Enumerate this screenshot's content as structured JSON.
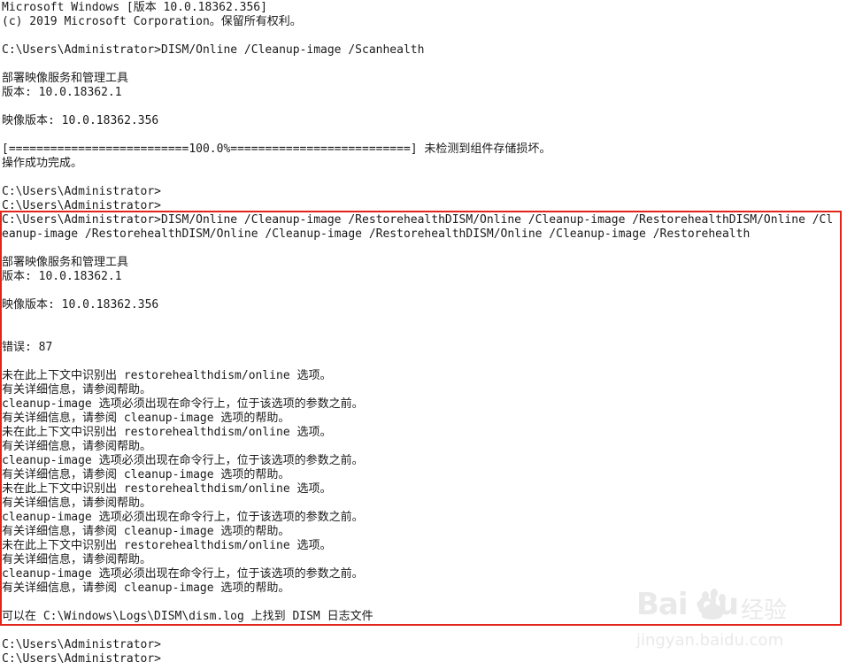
{
  "window": {
    "title_line": "Microsoft Windows [版本 10.0.18362.356]",
    "copyright_line": "(c) 2019 Microsoft Corporation。保留所有权利。"
  },
  "session1": {
    "command": "C:\\Users\\Administrator>DISM/Online /Cleanup-image /Scanhealth",
    "tool_name": "部署映像服务和管理工具",
    "tool_version": "版本: 10.0.18362.1",
    "image_version": "映像版本: 10.0.18362.356",
    "progress": "[==========================100.0%==========================] 未检测到组件存储损坏。",
    "result": "操作成功完成。",
    "prompt1": "C:\\Users\\Administrator>",
    "prompt2": "C:\\Users\\Administrator>"
  },
  "session2": {
    "command_line1": "C:\\Users\\Administrator>DISM/Online /Cleanup-image /RestorehealthDISM/Online /Cleanup-image /RestorehealthDISM/Online /Cl",
    "command_line2": "eanup-image /RestorehealthDISM/Online /Cleanup-image /RestorehealthDISM/Online /Cleanup-image /Restorehealth",
    "tool_name": "部署映像服务和管理工具",
    "tool_version": "版本: 10.0.18362.1",
    "image_version": "映像版本: 10.0.18362.356",
    "error": "错误: 87",
    "error_groups": [
      {
        "l1": "未在此上下文中识别出 restorehealthdism/online 选项。",
        "l2": "有关详细信息，请参阅帮助。",
        "l3": "cleanup-image 选项必须出现在命令行上，位于该选项的参数之前。",
        "l4": "有关详细信息，请参阅 cleanup-image 选项的帮助。"
      },
      {
        "l1": "未在此上下文中识别出 restorehealthdism/online 选项。",
        "l2": "有关详细信息，请参阅帮助。",
        "l3": "cleanup-image 选项必须出现在命令行上，位于该选项的参数之前。",
        "l4": "有关详细信息，请参阅 cleanup-image 选项的帮助。"
      },
      {
        "l1": "未在此上下文中识别出 restorehealthdism/online 选项。",
        "l2": "有关详细信息，请参阅帮助。",
        "l3": "cleanup-image 选项必须出现在命令行上，位于该选项的参数之前。",
        "l4": "有关详细信息，请参阅 cleanup-image 选项的帮助。"
      },
      {
        "l1": "未在此上下文中识别出 restorehealthdism/online 选项。",
        "l2": "有关详细信息，请参阅帮助。",
        "l3": "cleanup-image 选项必须出现在命令行上，位于该选项的参数之前。",
        "l4": "有关详细信息，请参阅 cleanup-image 选项的帮助。"
      }
    ],
    "log_line": "可以在 C:\\Windows\\Logs\\DISM\\dism.log 上找到 DISM 日志文件"
  },
  "trailing": {
    "prompt1": "C:\\Users\\Administrator>",
    "prompt2": "C:\\Users\\Administrator>"
  },
  "colors": {
    "background": "#ffffff",
    "text": "#1a1a1a",
    "highlight_border": "#e1251b"
  },
  "watermark": {
    "logo": "Bai du",
    "brand": "经验",
    "url": "jingyan.baidu.com"
  }
}
